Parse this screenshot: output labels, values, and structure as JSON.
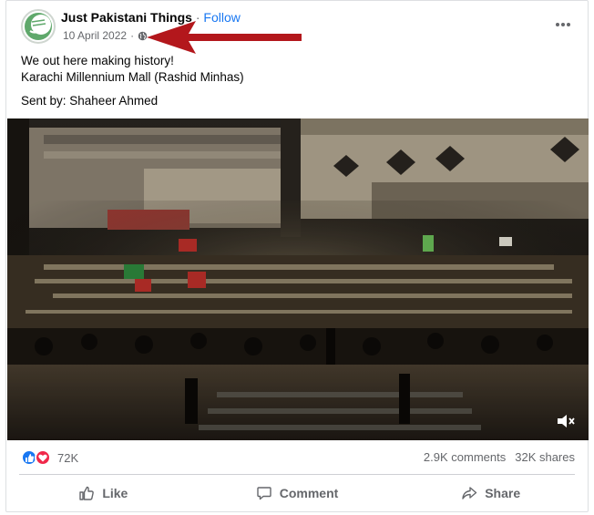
{
  "post": {
    "page_name": "Just Pakistani Things",
    "separator": "·",
    "follow_label": "Follow",
    "date": "10 April 2022",
    "date_separator": "·",
    "audience_icon": "globe-icon",
    "more_icon": "more-options-icon",
    "text_lines": [
      "We out here making history!",
      "Karachi Millennium Mall (Rashid Minhas)"
    ],
    "sent_by": "Sent by: Shaheer Ahmed",
    "video": {
      "mute_icon": "volume-muted-icon"
    }
  },
  "stats": {
    "reactions_count": "72K",
    "reaction_icons": [
      "like-icon",
      "love-icon"
    ],
    "comments": "2.9K comments",
    "shares": "32K shares"
  },
  "actions": {
    "like_label": "Like",
    "comment_label": "Comment",
    "share_label": "Share"
  },
  "colors": {
    "accent": "#1877f2",
    "annotation_arrow": "#b3171c",
    "like": "#1877f2",
    "love": "#f0284a",
    "muted_text": "#65676b"
  }
}
